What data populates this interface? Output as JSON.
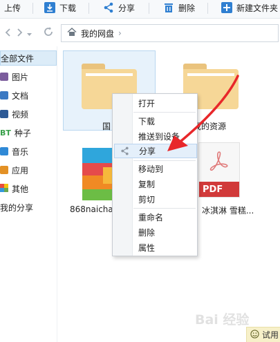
{
  "toolbar": {
    "upload": "上传",
    "download": "下载",
    "share": "分享",
    "delete": "删除",
    "new_folder": "新建文件夹"
  },
  "address": {
    "home_label": "我的网盘",
    "separator": "›"
  },
  "sidebar": {
    "items": [
      {
        "label": "全部文件",
        "icon": "all-files-icon"
      },
      {
        "label": "图片",
        "icon": "picture-icon",
        "color": "#7b5c9c"
      },
      {
        "label": "文档",
        "icon": "document-icon",
        "color": "#3b79c3"
      },
      {
        "label": "视频",
        "icon": "video-icon",
        "color": "#2d5a96"
      },
      {
        "label": "种子",
        "icon": "bt-icon",
        "color": "#39a04a"
      },
      {
        "label": "音乐",
        "icon": "music-icon",
        "color": "#2f89d6"
      },
      {
        "label": "应用",
        "icon": "app-icon",
        "color": "#e39125"
      },
      {
        "label": "其他",
        "icon": "other-icon",
        "color": "#6aa84f"
      },
      {
        "label": "我的分享",
        "icon": ""
      }
    ]
  },
  "files": [
    {
      "name": "国",
      "type": "folder"
    },
    {
      "name": "我的资源",
      "type": "folder"
    },
    {
      "name": "868naicha-",
      "type": "apk"
    },
    {
      "name": "冰淇淋 雪糕...",
      "type": "pdf"
    }
  ],
  "pdf_label": "PDF",
  "context_menu": {
    "items": [
      "打开",
      "下载",
      "推送到设备",
      "分享",
      "移动到",
      "复制",
      "剪切",
      "重命名",
      "删除",
      "属性"
    ],
    "highlighted": "分享"
  },
  "trial": {
    "label": "试用"
  },
  "watermark": "Bai 经验",
  "colors": {
    "accent": "#2f7fd1",
    "folder": "#f6d797",
    "pdf_red": "#d13a3a",
    "arrow_red": "#e8272a",
    "menu_hover": "#e4effa"
  }
}
